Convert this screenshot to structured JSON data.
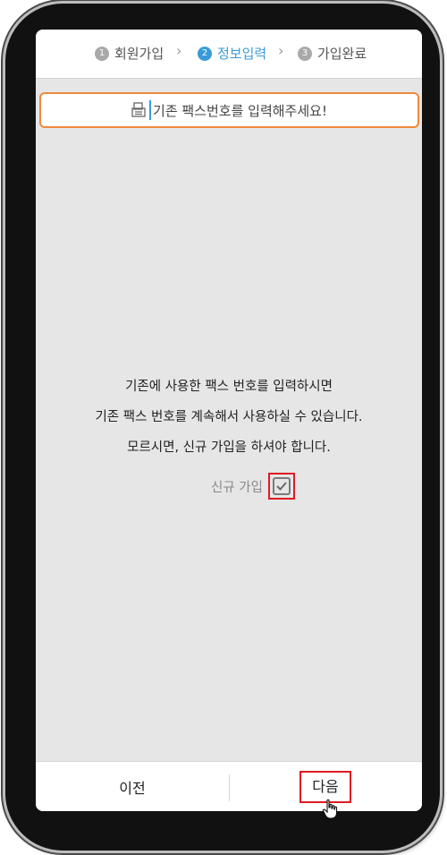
{
  "steps": [
    {
      "num": "1",
      "label": "회원가입"
    },
    {
      "num": "2",
      "label": "정보입력"
    },
    {
      "num": "3",
      "label": "가입완료"
    }
  ],
  "fax_input": {
    "placeholder": "기존 팩스번호를 입력해주세요!",
    "value": ""
  },
  "info": {
    "line1": "기존에 사용한 팩스 번호를 입력하시면",
    "line2": "기존 팩스 번호를 계속해서 사용하실 수 있습니다.",
    "line3": "모르시면, 신규 가입을 하셔야 합니다."
  },
  "new_join": {
    "label": "신규 가입",
    "checked": true
  },
  "buttons": {
    "prev": "이전",
    "next": "다음"
  },
  "colors": {
    "active_step": "#3a9ad9",
    "input_border": "#f08a3c",
    "highlight": "#e01a22"
  }
}
